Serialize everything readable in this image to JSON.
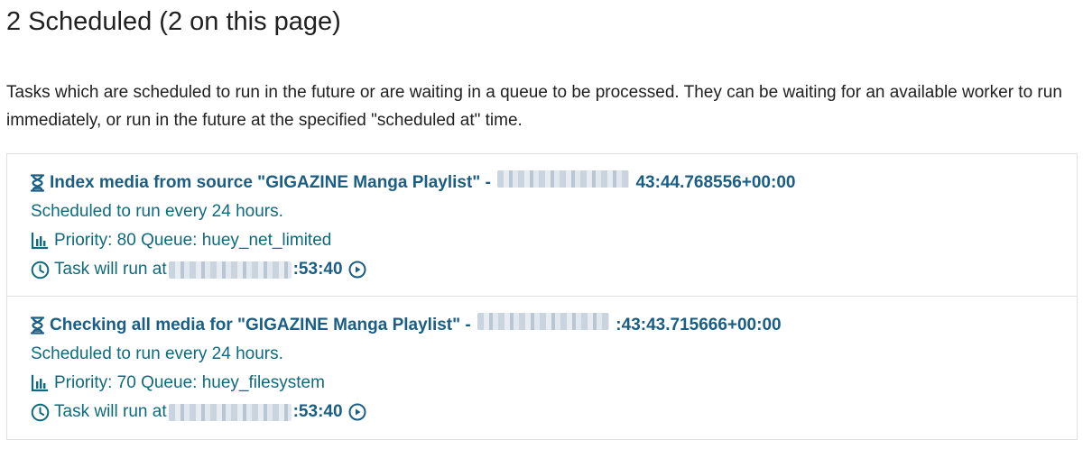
{
  "page": {
    "heading": "2 Scheduled (2 on this page)",
    "description": "Tasks which are scheduled to run in the future or are waiting in a queue to be processed. They can be waiting for an available worker to run immediately, or run in the future at the specified \"scheduled at\" time."
  },
  "tasks": [
    {
      "title_prefix": "Index media from source \"GIGAZINE Manga Playlist\" -",
      "title_suffix": "43:44.768556+00:00",
      "schedule": "Scheduled to run every 24 hours.",
      "priority_queue": "Priority: 80 Queue: huey_net_limited",
      "run_prefix": "Task will run at",
      "run_suffix": ":53:40",
      "icons": [
        "hourglass-icon",
        "bar-chart-icon",
        "clock-icon",
        "play-circle-icon"
      ]
    },
    {
      "title_prefix": "Checking all media for \"GIGAZINE Manga Playlist\" -",
      "title_suffix": ":43:43.715666+00:00",
      "schedule": "Scheduled to run every 24 hours.",
      "priority_queue": "Priority: 70 Queue: huey_filesystem",
      "run_prefix": "Task will run at",
      "run_suffix": ":53:40",
      "icons": [
        "hourglass-icon",
        "bar-chart-icon",
        "clock-icon",
        "play-circle-icon"
      ]
    }
  ],
  "colors": {
    "heading_text": "#212121",
    "task_title": "#1a5e84",
    "task_meta": "#0e6a7c",
    "border": "#e0e0e0"
  }
}
